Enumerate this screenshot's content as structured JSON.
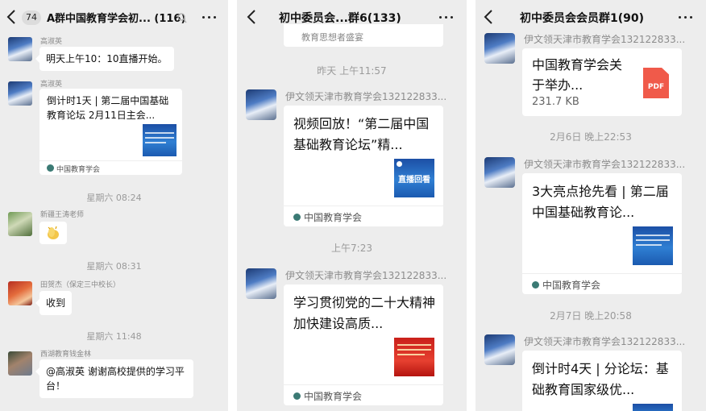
{
  "panel1": {
    "back_label": "",
    "unread_count": "74",
    "title": "A群中国教育学会初... (116)",
    "messages": {
      "m1": {
        "sender": "高淑英",
        "text": "明天上午10：10直播开始。"
      },
      "m2": {
        "sender": "高淑英",
        "card_title": "倒计时1天 | 第二届中国基础教育论坛 2月11日主会...",
        "source": "中国教育学会"
      },
      "t1": "星期六 08:24",
      "m3": {
        "sender": "新疆王涛老师",
        "emoji": "clapping-hands-icon"
      },
      "t2": "星期六 08:31",
      "m4": {
        "sender": "田贺杰（保定三中校长）",
        "text": "收到"
      },
      "t3": "星期六 11:48",
      "m5": {
        "sender": "西湖教育钱金林",
        "text": "@高淑英 谢谢高校提供的学习平台！"
      }
    }
  },
  "panel2": {
    "title": "初中委员会...群6(133)",
    "partial_text": "教育思想者盛宴",
    "t1": "昨天 上午11:57",
    "m1": {
      "sender": "伊文领天津市教育学会132122833...",
      "card_title": "视频回放！“第二届中国基础教育论坛”精...",
      "thumb_caption": "直播回看",
      "source": "中国教育学会"
    },
    "t2": "上午7:23",
    "m2": {
      "sender": "伊文领天津市教育学会132122833...",
      "card_title": "学习贯彻党的二十大精神 加快建设高质...",
      "source": "中国教育学会"
    }
  },
  "panel3": {
    "title": "初中委员会会员群1(90)",
    "m1": {
      "sender": "伊文领天津市教育学会132122833...",
      "file_title": "中国教育学会关于举办...",
      "file_size": "231.7 KB",
      "file_type": "PDF"
    },
    "t1": "2月6日 晚上22:53",
    "m2": {
      "sender": "伊文领天津市教育学会132122833...",
      "card_title": "3大亮点抢先看 | 第二届中国基础教育论...",
      "source": "中国教育学会"
    },
    "t2": "2月7日 晚上20:58",
    "m3": {
      "sender": "伊文领天津市教育学会132122833...",
      "card_title": "倒计时4天 | 分论坛：基础教育国家级优..."
    }
  },
  "colors": {
    "chat_bg": "#ededed",
    "bubble": "#ffffff",
    "pdf_red": "#f05a4a",
    "thumb_blue": "#2f7fd3",
    "thumb_red": "#e64030"
  }
}
